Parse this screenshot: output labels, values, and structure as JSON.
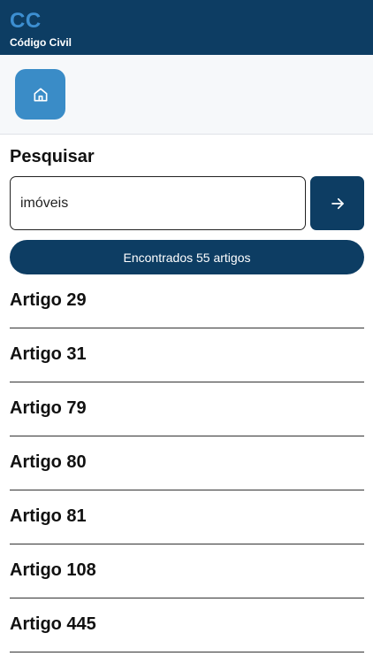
{
  "appbar": {
    "abbr": "CC",
    "title": "Código Civil"
  },
  "toolbar": {
    "home_icon": "home-icon"
  },
  "search": {
    "heading": "Pesquisar",
    "value": "imóveis",
    "submit_icon": "arrow-right-icon"
  },
  "results": {
    "summary": "Encontrados 55 artigos",
    "items": [
      {
        "label": "Artigo 29"
      },
      {
        "label": "Artigo 31"
      },
      {
        "label": "Artigo 79"
      },
      {
        "label": "Artigo 80"
      },
      {
        "label": "Artigo 81"
      },
      {
        "label": "Artigo 108"
      },
      {
        "label": "Artigo 445"
      }
    ]
  },
  "colors": {
    "primary": "#0d3d63",
    "accent": "#3a8cc7",
    "abbr": "#3d8fd1"
  }
}
